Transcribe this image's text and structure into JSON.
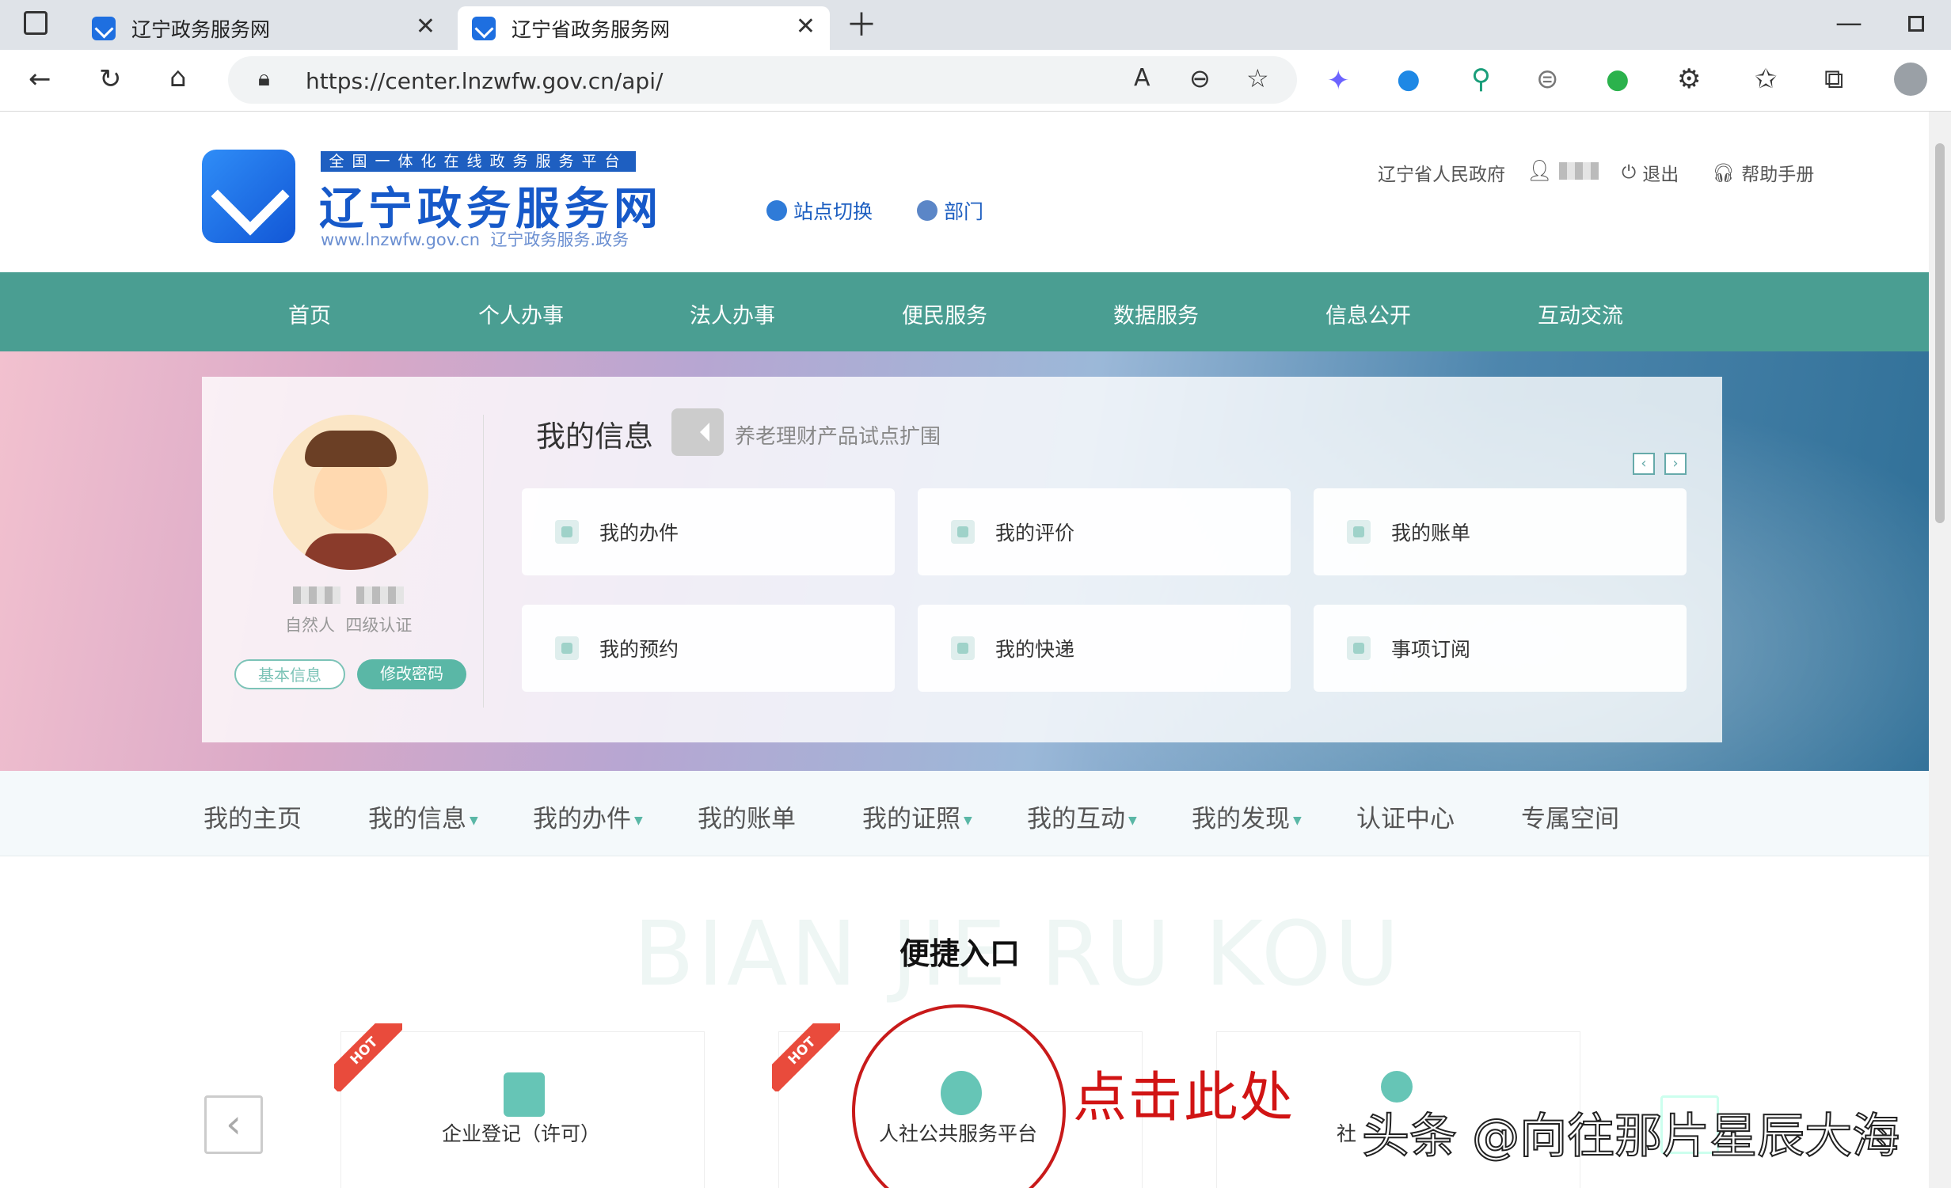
{
  "browser": {
    "tabs": [
      {
        "title": "辽宁政务服务网"
      },
      {
        "title": "辽宁省政务服务网"
      }
    ],
    "url": "https://center.lnzwfw.gov.cn/api/"
  },
  "header": {
    "slogan": "全国一体化在线政务服务平台",
    "site_name": "辽宁政务服务网",
    "site_url": "www.lnzwfw.gov.cn",
    "site_url_cn": "辽宁政务服务.政务",
    "site_switch": "站点切换",
    "department": "部门",
    "gov_link": "辽宁省人民政府",
    "logout": "退出",
    "help": "帮助手册"
  },
  "main_nav": [
    "首页",
    "个人办事",
    "法人办事",
    "便民服务",
    "数据服务",
    "信息公开",
    "互动交流"
  ],
  "profile": {
    "user_type": "自然人",
    "cert_level": "四级认证",
    "basic_info_btn": "基本信息",
    "change_pwd_btn": "修改密码"
  },
  "my_info": {
    "title": "我的信息",
    "notice": "养老理财产品试点扩围",
    "cards": [
      "我的办件",
      "我的评价",
      "我的账单",
      "我的预约",
      "我的快递",
      "事项订阅"
    ]
  },
  "sub_nav": [
    {
      "label": "我的主页",
      "dropdown": false
    },
    {
      "label": "我的信息",
      "dropdown": true
    },
    {
      "label": "我的办件",
      "dropdown": true
    },
    {
      "label": "我的账单",
      "dropdown": false
    },
    {
      "label": "我的证照",
      "dropdown": true
    },
    {
      "label": "我的互动",
      "dropdown": true
    },
    {
      "label": "我的发现",
      "dropdown": true
    },
    {
      "label": "认证中心",
      "dropdown": false
    },
    {
      "label": "专属空间",
      "dropdown": false
    }
  ],
  "quick_entry": {
    "bg_text": "BIAN JIE RU KOU",
    "title": "便捷入口",
    "items": [
      "企业登记（许可）",
      "人社公共服务平台",
      "社"
    ],
    "hot_badge": "HOT"
  },
  "annotation": {
    "text": "点击此处",
    "color": "#d11414"
  },
  "watermark": "头条 @向往那片星辰大海",
  "colors": {
    "nav_bg": "#4a9e92",
    "accent": "#5ab7a6",
    "brand_blue": "#1659c9"
  }
}
